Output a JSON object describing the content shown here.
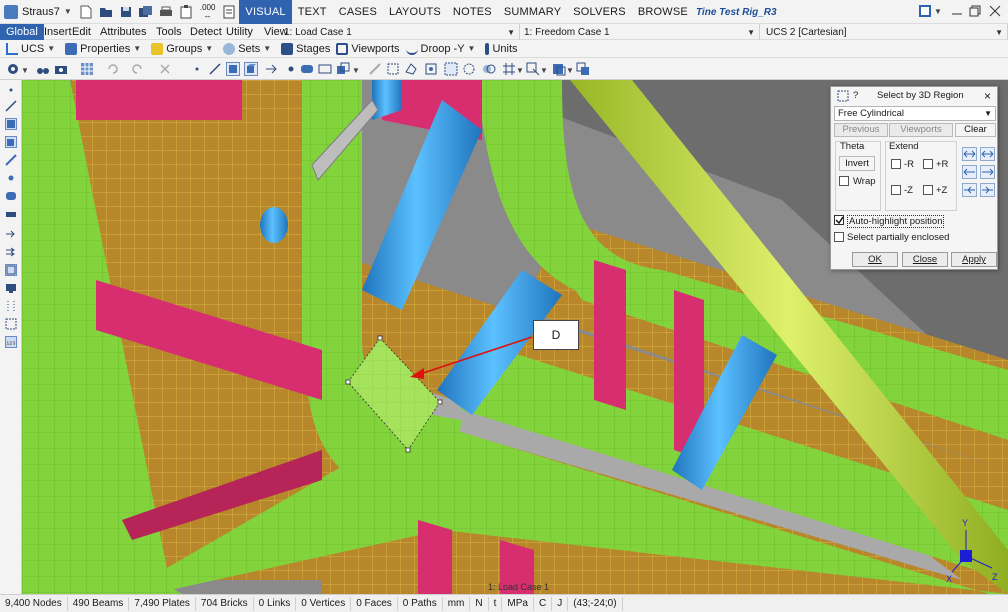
{
  "app": {
    "name": "Straus7",
    "file_title": "Tine Test Rig_R3",
    "format_label": ".000"
  },
  "menu": [
    "VISUAL",
    "TEXT",
    "CASES",
    "LAYOUTS",
    "NOTES",
    "SUMMARY",
    "SOLVERS",
    "BROWSE"
  ],
  "active_menu": "VISUAL",
  "tabs": [
    "Global",
    "Insert",
    "Edit",
    "Attributes",
    "Tools",
    "Detect",
    "Utility",
    "View"
  ],
  "combos": {
    "load_case": "1: Load Case 1",
    "freedom_case": "1: Freedom Case 1",
    "ucs": "UCS 2 [Cartesian]"
  },
  "toolbar3": {
    "ucs": "UCS",
    "properties": "Properties",
    "groups": "Groups",
    "sets": "Sets",
    "stages": "Stages",
    "viewports": "Viewports",
    "droop": "Droop -Y",
    "units": "Units"
  },
  "dialog": {
    "title": "Select by 3D Region",
    "help": "?",
    "close": "×",
    "region_type": "Free Cylindrical",
    "previous": "Previous",
    "viewports": "Viewports",
    "clear": "Clear",
    "theta_label": "Theta",
    "invert": "Invert",
    "wrap": "Wrap",
    "extend_label": "Extend",
    "neg_r": "-R",
    "pos_r": "+R",
    "neg_z": "-Z",
    "pos_z": "+Z",
    "auto_highlight": "Auto-highlight position",
    "auto_highlight_checked": true,
    "select_partial": "Select partially enclosed",
    "select_partial_checked": false,
    "ok": "OK",
    "close_btn": "Close",
    "apply": "Apply"
  },
  "callout": "D",
  "viewport_caption": "1: Load Case 1",
  "axes": {
    "x": "X",
    "y": "Y",
    "z": "Z"
  },
  "status": [
    "9,400 Nodes",
    "490 Beams",
    "7,490 Plates",
    "704 Bricks",
    "0 Links",
    "0 Vertices",
    "0 Faces",
    "0 Paths",
    "mm",
    "N",
    "t",
    "MPa",
    "C",
    "J",
    "(43;-24;0)"
  ],
  "colors": {
    "plate_green": "#82d33c",
    "plate_brown": "#b8862b",
    "plate_pink": "#d62e6f",
    "beam_blue": "#3a9fe0",
    "beam_yellow": "#b9d836",
    "gray_plate": "#a9a9a9",
    "accent": "#2f63b0"
  }
}
